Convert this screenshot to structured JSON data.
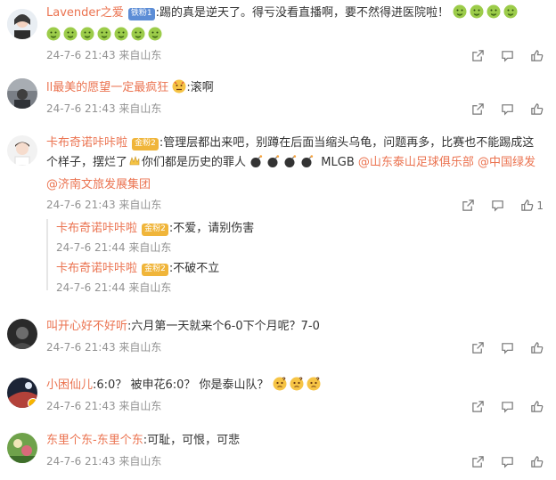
{
  "comments": [
    {
      "user": "Lavender之爱",
      "badge": "铁粉1",
      "text": ":踢的真是逆天了。得亏没看直播啊，要不然得进医院啦！",
      "meta": "24-7-6 21:43 来自山东"
    },
    {
      "user": "ll最美的愿望一定最疯狂",
      "text": ":滚啊",
      "meta": "24-7-6 21:43 来自山东"
    },
    {
      "user": "卡布奇诺咔咔啦",
      "badge": "金粉2",
      "text_a": ":管理层都出来吧，别蹲在后面当缩头乌龟，问题再多，比赛也不能踢成这个样子，摆烂了",
      "text_b": "你们都是历史的罪人",
      "text_c": " MLGB ",
      "links": [
        "@山东泰山足球俱乐部",
        "@中国绿发",
        "@济南文旅发展集团"
      ],
      "meta": "24-7-6 21:43 来自山东",
      "like_count": "1",
      "replies": [
        {
          "user": "卡布奇诺咔咔啦",
          "badge": "金粉2",
          "text": ":不爱，请别伤害",
          "meta": "24-7-6 21:44 来自山东"
        },
        {
          "user": "卡布奇诺咔咔啦",
          "badge": "金粉2",
          "text": ":不破不立",
          "meta": "24-7-6 21:44 来自山东"
        }
      ]
    },
    {
      "user": "叫开心好不好听",
      "text": ":六月第一天就来个6-0下个月呢？7-0",
      "meta": "24-7-6 21:43 来自山东"
    },
    {
      "user": "小困仙儿",
      "text": ":6:0？ 被申花6:0？ 你是泰山队？",
      "meta": "24-7-6 21:43 来自山东"
    },
    {
      "user": "东里个东-东里个东",
      "text": ":可耻，可恨，可悲",
      "meta": "24-7-6 21:43 来自山东"
    }
  ],
  "colors": {
    "username": "#eb7350",
    "meta": "#939393",
    "accent_badge_blue": "#5c8dd6",
    "accent_badge_gold": "#f0b53a"
  },
  "icons": {
    "reply": "share-arrow-icon",
    "comment": "comment-icon",
    "like": "thumbs-up-icon",
    "sick_emoji": "vomit-face-emoji",
    "bomb_emoji": "bomb-emoji",
    "confused_emoji": "confused-face-emoji"
  }
}
